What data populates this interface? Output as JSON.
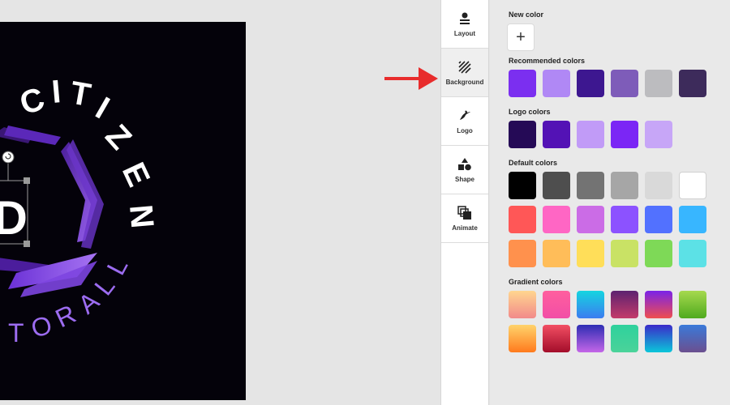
{
  "canvas": {
    "circle_text_top": "CITIZEN",
    "circle_text_bottom": "FOR ALL",
    "monogram": "D"
  },
  "toolbar": {
    "items": [
      {
        "label": "Layout",
        "icon": "layout-icon",
        "active": false
      },
      {
        "label": "Background",
        "icon": "background-icon",
        "active": true
      },
      {
        "label": "Logo",
        "icon": "logo-icon",
        "active": false
      },
      {
        "label": "Shape",
        "icon": "shape-icon",
        "active": false
      },
      {
        "label": "Animate",
        "icon": "animate-icon",
        "active": false
      }
    ]
  },
  "panel": {
    "new_color": {
      "title": "New color",
      "button": "+"
    },
    "recommended": {
      "title": "Recommended colors",
      "colors": [
        "#7b2ff0",
        "#b088f5",
        "#3d1790",
        "#7e5cb9",
        "#bcbcbf",
        "#3d2b5b"
      ]
    },
    "logo": {
      "title": "Logo colors",
      "colors": [
        "#250a56",
        "#5312b5",
        "#c19bf7",
        "#7b26f5",
        "#c7a6f7"
      ]
    },
    "default": {
      "title": "Default colors",
      "rows": [
        [
          "#000000",
          "#4e4e4e",
          "#737373",
          "#a6a6a6",
          "#d9d9d9",
          "#ffffff"
        ],
        [
          "#ff5757",
          "#ff66c4",
          "#cb6ce6",
          "#8c52ff",
          "#5271ff",
          "#38b6ff"
        ],
        [
          "#ff914d",
          "#ffbd59",
          "#ffde59",
          "#c9e265",
          "#7ed957",
          "#5ce1e6"
        ]
      ]
    },
    "gradient": {
      "title": "Gradient colors",
      "rows": [
        [
          [
            "#ffd68f",
            "#f28a8a"
          ],
          [
            "#ff5f9e",
            "#f24ea6"
          ],
          [
            "#15d5e0",
            "#3b7cf0"
          ],
          [
            "#5d2270",
            "#c43b6a"
          ],
          [
            "#7a22e8",
            "#ef4f4f"
          ],
          [
            "#a6d94e",
            "#4faa1e"
          ]
        ],
        [
          [
            "#ffd36b",
            "#ff7a1d"
          ],
          [
            "#f24e63",
            "#a30d2a"
          ],
          [
            "#2d2db3",
            "#c466e8"
          ],
          [
            "#2ed19c",
            "#4bd39a"
          ],
          [
            "#3a2ac9",
            "#0bc6d9"
          ],
          [
            "#3a7ad9",
            "#6b4f8f"
          ]
        ]
      ]
    }
  }
}
